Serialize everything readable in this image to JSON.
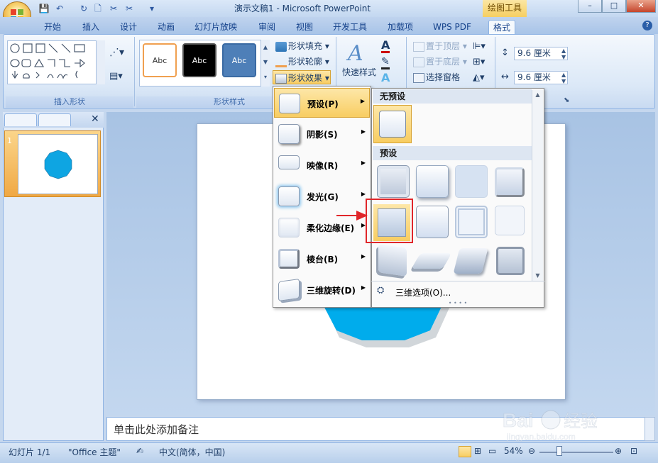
{
  "window": {
    "title": "演示文稿1 - Microsoft PowerPoint",
    "contextual_tab": "绘图工具",
    "min": "–",
    "max": "□",
    "close": "✕"
  },
  "quick_access": {
    "save": "💾",
    "undo": "↶",
    "redo": "↻"
  },
  "tabs": [
    "开始",
    "插入",
    "设计",
    "动画",
    "幻灯片放映",
    "审阅",
    "视图",
    "开发工具",
    "加载项",
    "WPS PDF",
    "格式"
  ],
  "help": "?",
  "ribbon": {
    "insert_shapes_label": "插入形状",
    "shape_styles_label": "形状样式",
    "style_thumbs": [
      "Abc",
      "Abc",
      "Abc"
    ],
    "shape_fill": "形状填充",
    "shape_outline": "形状轮廓",
    "shape_effects": "形状效果",
    "quick_styles": "快速样式",
    "bring_front": "置于顶层",
    "send_back": "置于底层",
    "selection_pane": "选择窗格",
    "height_value": "9.6 厘米",
    "width_value": "9.6 厘米"
  },
  "left_pane": {
    "slide_number": "1"
  },
  "notes_placeholder": "单击此处添加备注",
  "status": {
    "slide": "幻灯片 1/1",
    "theme": "\"Office 主题\"",
    "language": "中文(简体，中国)",
    "zoom": "54%"
  },
  "effects_menu": [
    {
      "label": "预设(P)"
    },
    {
      "label": "阴影(S)"
    },
    {
      "label": "映像(R)"
    },
    {
      "label": "发光(G)"
    },
    {
      "label": "柔化边缘(E)"
    },
    {
      "label": "棱台(B)"
    },
    {
      "label": "三维旋转(D)"
    }
  ],
  "presets_panel": {
    "no_preset": "无预设",
    "preset": "预设",
    "three_d_options": "三维选项(O)...",
    "grip": "• • • •"
  },
  "colors": {
    "shape_blue": "#0ea5e2",
    "accent_orange": "#f0a844",
    "highlight_red": "#e0262a"
  },
  "watermark": {
    "text": "Bai 经验",
    "url": "jingyan.baidu.com"
  }
}
